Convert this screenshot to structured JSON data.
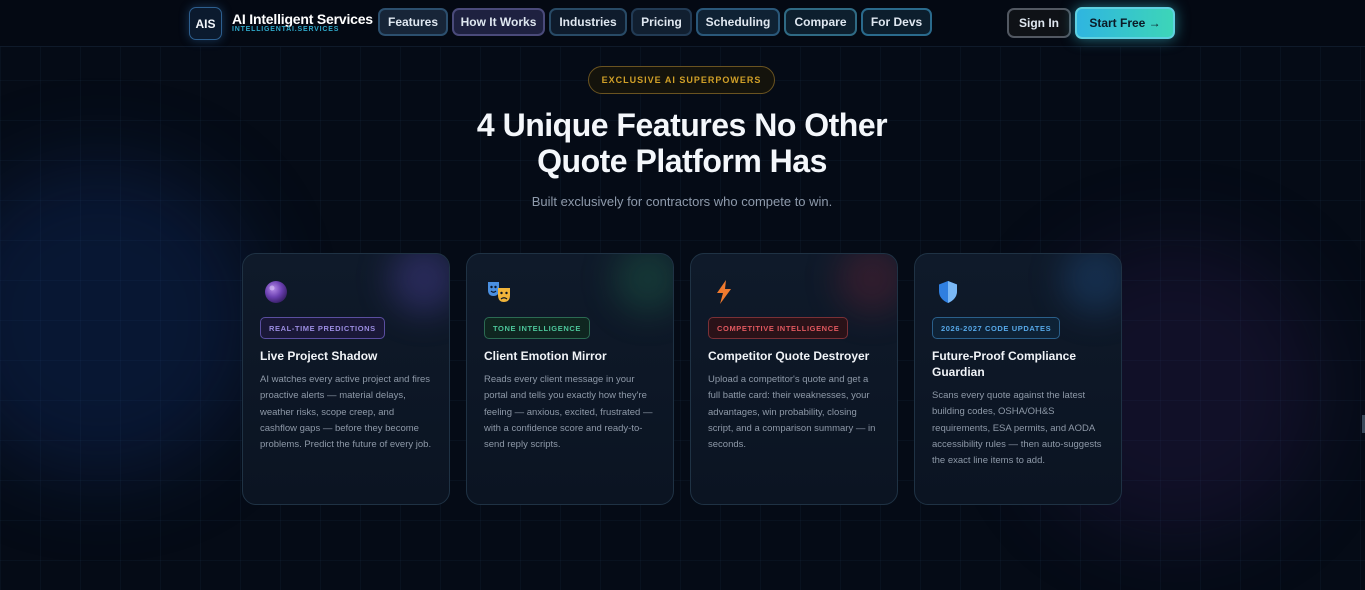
{
  "brand": {
    "logo_text": "AIS",
    "name": "AI Intelligent Services",
    "domain": "INTELLIGENTAI.SERVICES"
  },
  "nav": {
    "items": [
      "Features",
      "How It Works",
      "Industries",
      "Pricing",
      "Scheduling",
      "Compare",
      "For Devs"
    ],
    "sign_in": "Sign In",
    "start_free": "Start Free →"
  },
  "header": {
    "eyebrow": "EXCLUSIVE AI SUPERPOWERS",
    "headline_line1": "4 Unique Features No Other",
    "headline_line2": "Quote Platform Has",
    "subheadline": "Built exclusively for contractors who compete to win."
  },
  "cards": [
    {
      "icon": "crystal-ball-icon",
      "tag": "REAL-TIME PREDICTIONS",
      "title": "Live Project Shadow",
      "body": "AI watches every active project and fires proactive alerts — material delays, weather risks, scope creep, and cashflow gaps — before they become problems. Predict the future of every job.",
      "accent": "#9a8ce0"
    },
    {
      "icon": "theater-masks-icon",
      "tag": "TONE INTELLIGENCE",
      "title": "Client Emotion Mirror",
      "body": "Reads every client message in your portal and tells you exactly how they're feeling — anxious, excited, frustrated — with a confidence score and ready-to-send reply scripts.",
      "accent": "#4cc59a"
    },
    {
      "icon": "lightning-bolt-icon",
      "tag": "COMPETITIVE INTELLIGENCE",
      "title": "Competitor Quote Destroyer",
      "body": "Upload a competitor's quote and get a full battle card: their weaknesses, your advantages, win probability, closing script, and a comparison summary — in seconds.",
      "accent": "#e0585f"
    },
    {
      "icon": "shield-icon",
      "tag": "2026-2027 CODE UPDATES",
      "title": "Future-Proof Compliance Guardian",
      "body": "Scans every quote against the latest building codes, OSHA/OH&S requirements, ESA permits, and AODA accessibility rules — then auto-suggests the exact line items to add.",
      "accent": "#56a8e8"
    }
  ],
  "colors": {
    "background": "#050b16",
    "cta_gradient_start": "#2fb5e0",
    "cta_gradient_end": "#3dd5b8",
    "eyebrow_gold": "#d1a028"
  }
}
